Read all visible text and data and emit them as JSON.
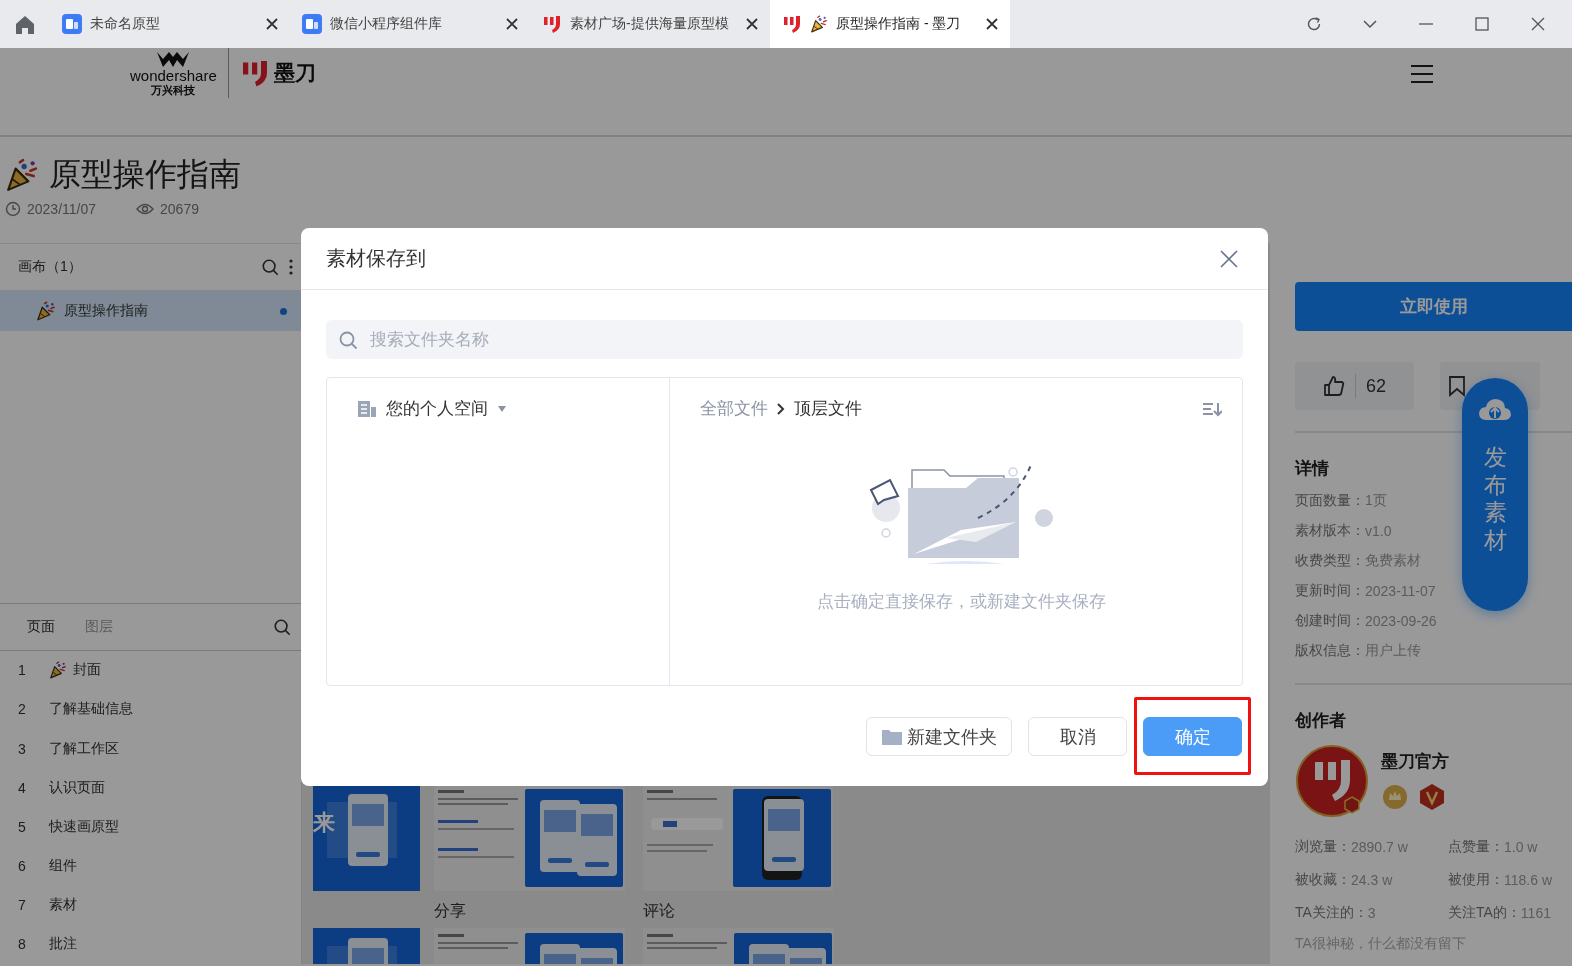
{
  "browser_tabs": [
    {
      "title": "未命名原型",
      "kind": "app",
      "selected": false
    },
    {
      "title": "微信小程序组件库",
      "kind": "app",
      "selected": false
    },
    {
      "title": "素材广场-提供海量原型模",
      "kind": "brand",
      "selected": false
    },
    {
      "title": "原型操作指南 - 墨刀",
      "kind": "document",
      "selected": true
    }
  ],
  "header": {
    "brand": "wondershare",
    "brand_sub": "万兴科技",
    "product": "墨刀"
  },
  "document": {
    "title": "原型操作指南",
    "date": "2023/11/07",
    "views": "20679"
  },
  "canvas_panel": {
    "title": "画布（1）",
    "items": [
      {
        "label": "原型操作指南",
        "selected": true
      }
    ]
  },
  "page_panel": {
    "tabs": [
      {
        "label": "页面",
        "selected": true
      },
      {
        "label": "图层",
        "selected": false
      }
    ],
    "pages": [
      {
        "number": "1",
        "label": "封面",
        "kind": "cover"
      },
      {
        "number": "2",
        "label": "了解基础信息",
        "kind": "page"
      },
      {
        "number": "3",
        "label": "了解工作区",
        "kind": "page"
      },
      {
        "number": "4",
        "label": "认识页面",
        "kind": "page"
      },
      {
        "number": "5",
        "label": "快速画原型",
        "kind": "page"
      },
      {
        "number": "6",
        "label": "组件",
        "kind": "page"
      },
      {
        "number": "7",
        "label": "素材",
        "kind": "page"
      },
      {
        "number": "8",
        "label": "批注",
        "kind": "page"
      }
    ]
  },
  "preview": {
    "thumbnails": [
      {
        "kind": "cover",
        "text": "来"
      },
      {
        "kind": "doc"
      },
      {
        "kind": "phone"
      }
    ],
    "captions": [
      "分享",
      "评论"
    ],
    "second_row": [
      {
        "kind": "cover"
      },
      {
        "kind": "doc"
      },
      {
        "kind": "doc"
      }
    ]
  },
  "side": {
    "use_button": "立即使用",
    "likes": "62",
    "details_title": "详情",
    "details": [
      {
        "label": "页面数量：",
        "value": "1页"
      },
      {
        "label": "素材版本：",
        "value": "v1.0"
      },
      {
        "label": "收费类型：",
        "value": " 免费素材"
      },
      {
        "label": "更新时间：",
        "value": "2023-11-07"
      },
      {
        "label": "创建时间：",
        "value": "2023-09-26"
      },
      {
        "label": "版权信息：",
        "value": "用户上传"
      }
    ],
    "creator_title": "创作者",
    "creator_name": "墨刀官方",
    "stats": [
      {
        "label": "浏览量：",
        "value": "2890.7 w"
      },
      {
        "label": "点赞量：",
        "value": "1.0 w"
      },
      {
        "label": "被收藏：",
        "value": "24.3 w"
      },
      {
        "label": "被使用：",
        "value": "118.6 w"
      },
      {
        "label": "TA关注的：",
        "value": "3"
      },
      {
        "label": "关注TA的：",
        "value": "1161"
      }
    ],
    "bio": "TA很神秘，什么都没有留下"
  },
  "publish_button": "发布素材",
  "dialog": {
    "title": "素材保存到",
    "search_placeholder": "搜索文件夹名称",
    "space": "您的个人空间",
    "breadcrumb": [
      "全部文件",
      "顶层文件"
    ],
    "empty_message": "点击确定直接保存，或新建文件夹保存",
    "buttons": [
      {
        "label": "新建文件夹",
        "kind": "folder",
        "highlighted": false
      },
      {
        "label": "取消",
        "kind": "plain",
        "highlighted": false
      },
      {
        "label": "确定",
        "kind": "primary",
        "highlighted": true
      }
    ]
  }
}
